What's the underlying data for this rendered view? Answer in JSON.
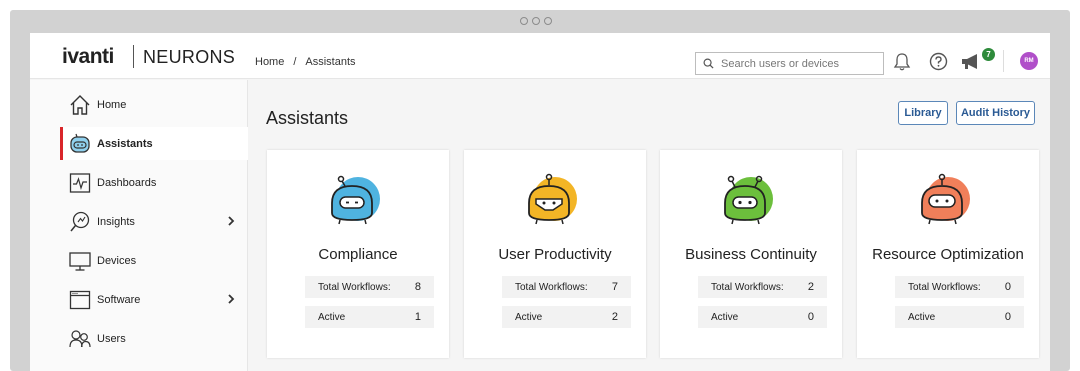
{
  "brand": {
    "logo": "ivanti",
    "product": "NEURONS"
  },
  "breadcrumb": {
    "home": "Home",
    "sep": "/",
    "current": "Assistants"
  },
  "search": {
    "placeholder": "Search users or devices"
  },
  "notifications": {
    "badge_count": "7"
  },
  "user": {
    "initials": "RM",
    "avatar_color": "#b04fc9"
  },
  "sidebar": {
    "items": [
      {
        "label": "Home",
        "icon": "home-icon"
      },
      {
        "label": "Assistants",
        "icon": "robot-icon",
        "active": true
      },
      {
        "label": "Dashboards",
        "icon": "dashboard-icon"
      },
      {
        "label": "Insights",
        "icon": "insights-icon",
        "has_submenu": true
      },
      {
        "label": "Devices",
        "icon": "monitor-icon"
      },
      {
        "label": "Software",
        "icon": "software-window-icon",
        "has_submenu": true
      },
      {
        "label": "Users",
        "icon": "users-icon"
      }
    ]
  },
  "main": {
    "title": "Assistants",
    "buttons": {
      "library": "Library",
      "audit_history": "Audit History"
    },
    "cards": [
      {
        "title": "Compliance",
        "color": "#4fb3e0",
        "workflows_label": "Total Workflows:",
        "workflows": "8",
        "active_label": "Active",
        "active": "1"
      },
      {
        "title": "User Productivity",
        "color": "#f3b526",
        "workflows_label": "Total Workflows:",
        "workflows": "7",
        "active_label": "Active",
        "active": "2"
      },
      {
        "title": "Business Continuity",
        "color": "#6cbf3c",
        "workflows_label": "Total Workflows:",
        "workflows": "2",
        "active_label": "Active",
        "active": "0"
      },
      {
        "title": "Resource Optimization",
        "color": "#f07f5a",
        "workflows_label": "Total Workflows:",
        "workflows": "0",
        "active_label": "Active",
        "active": "0"
      }
    ]
  },
  "colors": {
    "accent_red": "#d9262a",
    "link_blue": "#2a5a94"
  }
}
